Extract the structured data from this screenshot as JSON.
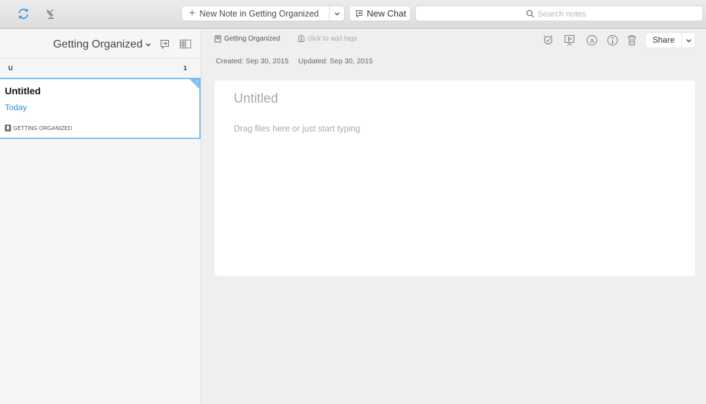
{
  "toolbar": {
    "sync_icon": "sync-icon",
    "activity_icon": "work-chat-antenna-icon",
    "new_note_label": "New Note in Getting Organized",
    "new_note_plus": "+",
    "new_note_caret": "⌄",
    "new_chat_label": "New Chat",
    "search_placeholder": "Search notes",
    "search_value": ""
  },
  "sidebar": {
    "notebook_title": "Getting Organized",
    "notebook_chevron": "⌄",
    "group_letter": "U",
    "group_count": "1",
    "notes": [
      {
        "title": "Untitled",
        "date": "Today",
        "notebook": "GETTING ORGANIZED",
        "shortcut_marker": "↑"
      }
    ]
  },
  "note": {
    "notebook": "Getting Organized",
    "tags_placeholder": "click to add tags",
    "created": "Created: Sep 30, 2015",
    "updated": "Updated: Sep 30, 2015",
    "title_placeholder": "Untitled",
    "body_placeholder": "Drag files here or just start typing",
    "share_label": "Share",
    "share_caret": "⌄",
    "action_icons": [
      "reminder-icon",
      "presentation-icon",
      "at-mention-icon",
      "info-icon",
      "trash-icon"
    ]
  },
  "colors": {
    "accent": "#2b8fd8",
    "selection_border": "#7fbef0"
  }
}
